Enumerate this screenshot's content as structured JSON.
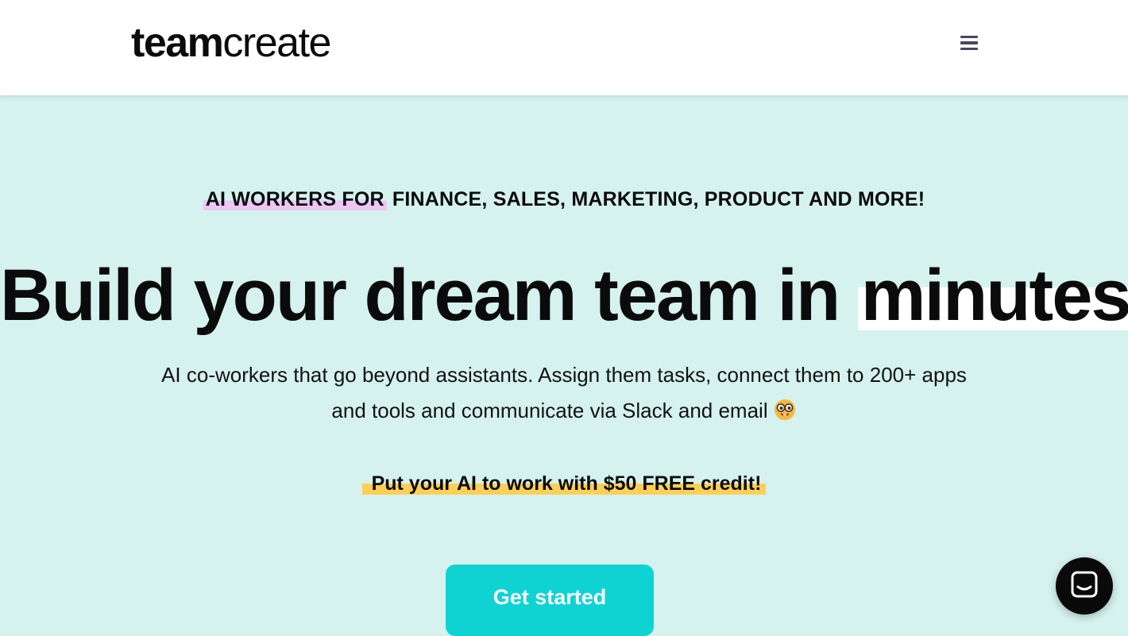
{
  "header": {
    "logo_bold": "team",
    "logo_light": "create",
    "menu_icon": "hamburger-menu-icon"
  },
  "hero": {
    "eyebrow_highlight": "AI WORKERS FOR",
    "eyebrow_rest": " FINANCE, SALES, MARKETING, PRODUCT AND MORE!",
    "headline_main": "Build your dream team in",
    "headline_highlight": "minutes",
    "subtext": "AI co-workers that go beyond assistants. Assign them tasks, connect them to 200+ apps and tools and communicate via Slack and email",
    "subtext_emoji_icon": "nerd-face-emoji-icon",
    "promo": "Put your AI to work with $50 FREE credit!",
    "cta_label": "Get started"
  },
  "chat_widget": {
    "icon": "chat-bubble-icon"
  },
  "colors": {
    "background": "#d5f2ee",
    "cta": "#0fd3d3",
    "highlight_pink": "#ecc7f4",
    "highlight_yellow": "#ffcf56",
    "header_bg": "#ffffff"
  }
}
